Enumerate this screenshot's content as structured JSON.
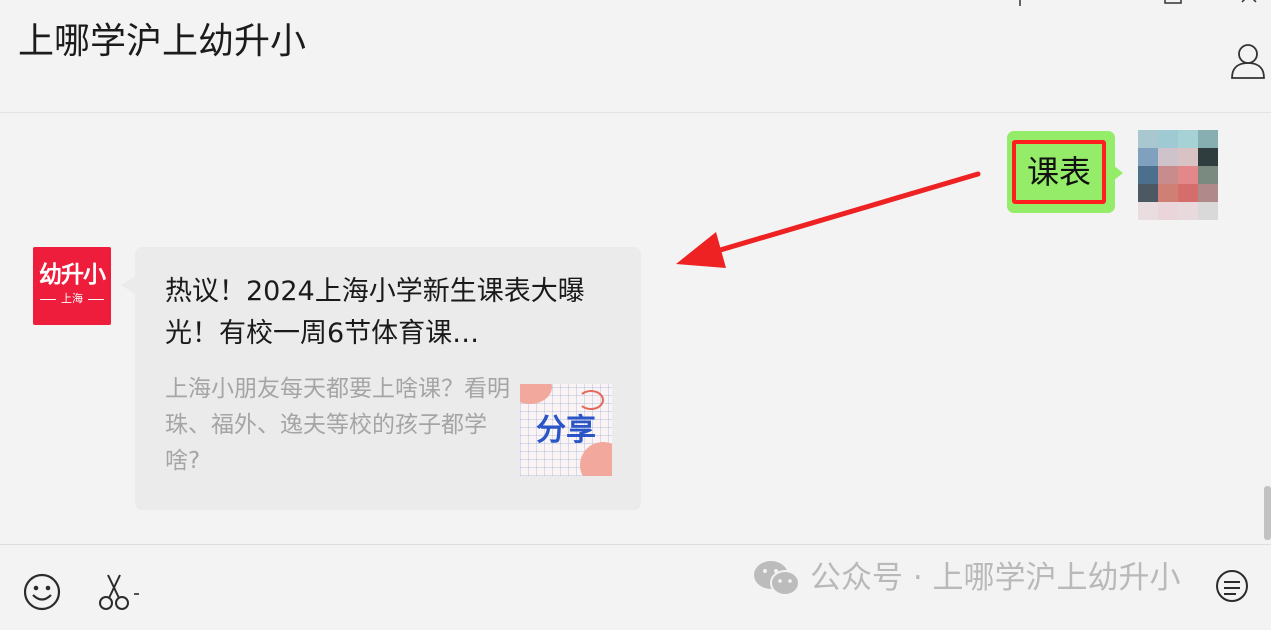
{
  "header": {
    "title": "上哪学沪上幼升小"
  },
  "messages": {
    "outgoing": {
      "text": "课表"
    },
    "incoming": {
      "avatar_logo": {
        "main": "幼升小",
        "sub": "上海"
      },
      "card": {
        "title": "热议！2024上海小学新生课表大曝光！有校一周6节体育课…",
        "description": "上海小朋友每天都要上啥课？看明珠、福外、逸夫等校的孩子都学啥?",
        "thumbnail_text": "分享"
      }
    }
  },
  "watermark": {
    "text": "公众号 · 上哪学沪上幼升小"
  },
  "colors": {
    "outgoing_bubble": "#95ec69",
    "highlight": "#ff1f1f",
    "arrow": "#ee2222",
    "logo_bg": "#ee1d3c",
    "card_bg": "#ebebeb"
  },
  "icons": [
    "pin-icon",
    "minimize-icon",
    "maximize-icon",
    "close-icon",
    "profile-icon",
    "emoji-icon",
    "scissors-icon",
    "more-icon",
    "wechat-icon"
  ]
}
